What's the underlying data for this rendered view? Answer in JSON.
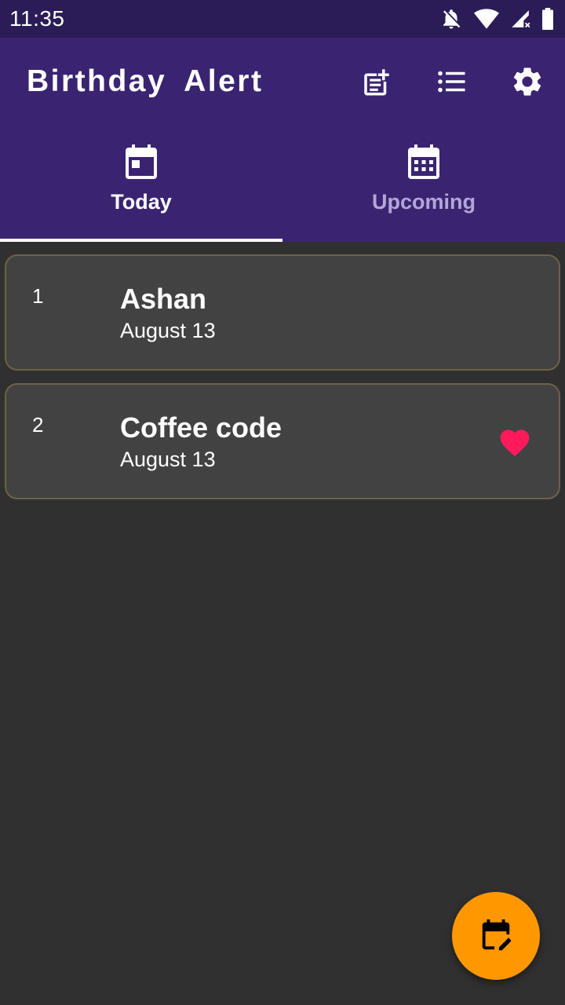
{
  "status_bar": {
    "time": "11:35",
    "icons": [
      "notifications-off-icon",
      "wifi-icon",
      "cell-signal-icon",
      "battery-icon"
    ]
  },
  "app_bar": {
    "title": "Birthday  Alert",
    "actions": [
      {
        "icon": "add-note-icon"
      },
      {
        "icon": "list-icon"
      },
      {
        "icon": "settings-icon"
      }
    ],
    "background": "#3a2472"
  },
  "tabs": [
    {
      "label": "Today",
      "icon": "calendar-today-icon",
      "active": true
    },
    {
      "label": "Upcoming",
      "icon": "calendar-month-icon",
      "active": false
    }
  ],
  "birthdays": [
    {
      "index": "1",
      "name": "Ashan",
      "date": "August 13",
      "favorite": false
    },
    {
      "index": "2",
      "name": "Coffee code",
      "date": "August 13",
      "favorite": true
    }
  ],
  "fab": {
    "icon": "edit-calendar-icon",
    "color": "#ff9800"
  },
  "colors": {
    "background": "#303030",
    "card": "#424242",
    "heart": "#ff1a5c",
    "accent": "#ff9800"
  }
}
